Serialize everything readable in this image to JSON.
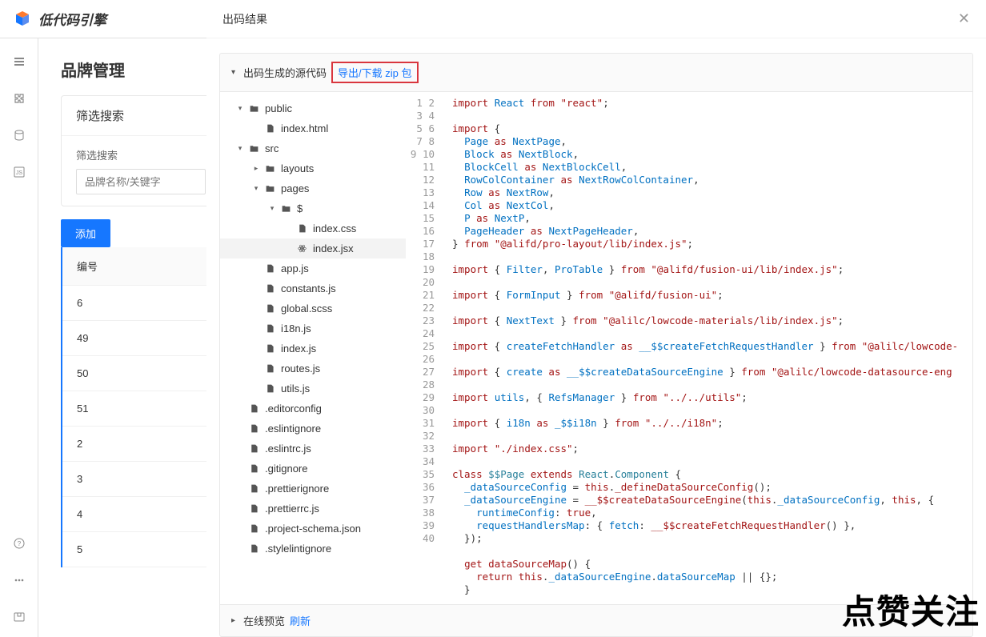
{
  "header": {
    "app_name": "低代码引擎"
  },
  "page": {
    "title": "品牌管理",
    "filter_panel_title": "筛选搜索",
    "filter_label": "筛选搜索",
    "filter_placeholder": "品牌名称/关键字",
    "add_button": "添加",
    "table_header": "编号",
    "rows": [
      "6",
      "49",
      "50",
      "51",
      "2",
      "3",
      "4",
      "5"
    ]
  },
  "modal": {
    "title": "出码结果",
    "section_title": "出码生成的源代码",
    "export_link": "导出/下载 zip 包",
    "footer_label": "在线预览",
    "footer_refresh": "刷新"
  },
  "tree": [
    {
      "d": 1,
      "caret": "v",
      "icon": "folder",
      "label": "public"
    },
    {
      "d": 2,
      "caret": "",
      "icon": "file",
      "label": "index.html"
    },
    {
      "d": 1,
      "caret": "v",
      "icon": "folder",
      "label": "src"
    },
    {
      "d": 2,
      "caret": ">",
      "icon": "folder",
      "label": "layouts"
    },
    {
      "d": 2,
      "caret": "v",
      "icon": "folder",
      "label": "pages"
    },
    {
      "d": 3,
      "caret": "v",
      "icon": "folder",
      "label": "$"
    },
    {
      "d": 4,
      "caret": "",
      "icon": "file",
      "label": "index.css"
    },
    {
      "d": 4,
      "caret": "",
      "icon": "react",
      "label": "index.jsx",
      "sel": true
    },
    {
      "d": 2,
      "caret": "",
      "icon": "file",
      "label": "app.js"
    },
    {
      "d": 2,
      "caret": "",
      "icon": "file",
      "label": "constants.js"
    },
    {
      "d": 2,
      "caret": "",
      "icon": "file",
      "label": "global.scss"
    },
    {
      "d": 2,
      "caret": "",
      "icon": "file",
      "label": "i18n.js"
    },
    {
      "d": 2,
      "caret": "",
      "icon": "file",
      "label": "index.js"
    },
    {
      "d": 2,
      "caret": "",
      "icon": "file",
      "label": "routes.js"
    },
    {
      "d": 2,
      "caret": "",
      "icon": "file",
      "label": "utils.js"
    },
    {
      "d": 1,
      "caret": "",
      "icon": "file",
      "label": ".editorconfig"
    },
    {
      "d": 1,
      "caret": "",
      "icon": "file",
      "label": ".eslintignore"
    },
    {
      "d": 1,
      "caret": "",
      "icon": "file",
      "label": ".eslintrc.js"
    },
    {
      "d": 1,
      "caret": "",
      "icon": "file",
      "label": ".gitignore"
    },
    {
      "d": 1,
      "caret": "",
      "icon": "file",
      "label": ".prettierignore"
    },
    {
      "d": 1,
      "caret": "",
      "icon": "file",
      "label": ".prettierrc.js"
    },
    {
      "d": 1,
      "caret": "",
      "icon": "file",
      "label": ".project-schema.json"
    },
    {
      "d": 1,
      "caret": "",
      "icon": "file",
      "label": ".stylelintignore"
    }
  ],
  "code": {
    "line_count": 40,
    "lines": [
      [
        [
          "kw",
          "import"
        ],
        [
          "pln",
          " "
        ],
        [
          "id",
          "React"
        ],
        [
          "pln",
          " "
        ],
        [
          "kw",
          "from"
        ],
        [
          "pln",
          " "
        ],
        [
          "str",
          "\"react\""
        ],
        [
          "pln",
          ";"
        ]
      ],
      [],
      [
        [
          "kw",
          "import"
        ],
        [
          "pln",
          " {"
        ]
      ],
      [
        [
          "pln",
          "  "
        ],
        [
          "id",
          "Page"
        ],
        [
          "pln",
          " "
        ],
        [
          "kw",
          "as"
        ],
        [
          "pln",
          " "
        ],
        [
          "id",
          "NextPage"
        ],
        [
          "pln",
          ","
        ]
      ],
      [
        [
          "pln",
          "  "
        ],
        [
          "id",
          "Block"
        ],
        [
          "pln",
          " "
        ],
        [
          "kw",
          "as"
        ],
        [
          "pln",
          " "
        ],
        [
          "id",
          "NextBlock"
        ],
        [
          "pln",
          ","
        ]
      ],
      [
        [
          "pln",
          "  "
        ],
        [
          "id",
          "BlockCell"
        ],
        [
          "pln",
          " "
        ],
        [
          "kw",
          "as"
        ],
        [
          "pln",
          " "
        ],
        [
          "id",
          "NextBlockCell"
        ],
        [
          "pln",
          ","
        ]
      ],
      [
        [
          "pln",
          "  "
        ],
        [
          "id",
          "RowColContainer"
        ],
        [
          "pln",
          " "
        ],
        [
          "kw",
          "as"
        ],
        [
          "pln",
          " "
        ],
        [
          "id",
          "NextRowColContainer"
        ],
        [
          "pln",
          ","
        ]
      ],
      [
        [
          "pln",
          "  "
        ],
        [
          "id",
          "Row"
        ],
        [
          "pln",
          " "
        ],
        [
          "kw",
          "as"
        ],
        [
          "pln",
          " "
        ],
        [
          "id",
          "NextRow"
        ],
        [
          "pln",
          ","
        ]
      ],
      [
        [
          "pln",
          "  "
        ],
        [
          "id",
          "Col"
        ],
        [
          "pln",
          " "
        ],
        [
          "kw",
          "as"
        ],
        [
          "pln",
          " "
        ],
        [
          "id",
          "NextCol"
        ],
        [
          "pln",
          ","
        ]
      ],
      [
        [
          "pln",
          "  "
        ],
        [
          "id",
          "P"
        ],
        [
          "pln",
          " "
        ],
        [
          "kw",
          "as"
        ],
        [
          "pln",
          " "
        ],
        [
          "id",
          "NextP"
        ],
        [
          "pln",
          ","
        ]
      ],
      [
        [
          "pln",
          "  "
        ],
        [
          "id",
          "PageHeader"
        ],
        [
          "pln",
          " "
        ],
        [
          "kw",
          "as"
        ],
        [
          "pln",
          " "
        ],
        [
          "id",
          "NextPageHeader"
        ],
        [
          "pln",
          ","
        ]
      ],
      [
        [
          "pln",
          "} "
        ],
        [
          "kw",
          "from"
        ],
        [
          "pln",
          " "
        ],
        [
          "str",
          "\"@alifd/pro-layout/lib/index.js\""
        ],
        [
          "pln",
          ";"
        ]
      ],
      [],
      [
        [
          "kw",
          "import"
        ],
        [
          "pln",
          " { "
        ],
        [
          "id",
          "Filter"
        ],
        [
          "pln",
          ", "
        ],
        [
          "id",
          "ProTable"
        ],
        [
          "pln",
          " } "
        ],
        [
          "kw",
          "from"
        ],
        [
          "pln",
          " "
        ],
        [
          "str",
          "\"@alifd/fusion-ui/lib/index.js\""
        ],
        [
          "pln",
          ";"
        ]
      ],
      [],
      [
        [
          "kw",
          "import"
        ],
        [
          "pln",
          " { "
        ],
        [
          "id",
          "FormInput"
        ],
        [
          "pln",
          " } "
        ],
        [
          "kw",
          "from"
        ],
        [
          "pln",
          " "
        ],
        [
          "str",
          "\"@alifd/fusion-ui\""
        ],
        [
          "pln",
          ";"
        ]
      ],
      [],
      [
        [
          "kw",
          "import"
        ],
        [
          "pln",
          " { "
        ],
        [
          "id",
          "NextText"
        ],
        [
          "pln",
          " } "
        ],
        [
          "kw",
          "from"
        ],
        [
          "pln",
          " "
        ],
        [
          "str",
          "\"@alilc/lowcode-materials/lib/index.js\""
        ],
        [
          "pln",
          ";"
        ]
      ],
      [],
      [
        [
          "kw",
          "import"
        ],
        [
          "pln",
          " { "
        ],
        [
          "id",
          "createFetchHandler"
        ],
        [
          "pln",
          " "
        ],
        [
          "kw",
          "as"
        ],
        [
          "pln",
          " "
        ],
        [
          "id",
          "__$$createFetchRequestHandler"
        ],
        [
          "pln",
          " } "
        ],
        [
          "kw",
          "from"
        ],
        [
          "pln",
          " "
        ],
        [
          "str",
          "\"@alilc/lowcode-"
        ]
      ],
      [],
      [
        [
          "kw",
          "import"
        ],
        [
          "pln",
          " { "
        ],
        [
          "id",
          "create"
        ],
        [
          "pln",
          " "
        ],
        [
          "kw",
          "as"
        ],
        [
          "pln",
          " "
        ],
        [
          "id",
          "__$$createDataSourceEngine"
        ],
        [
          "pln",
          " } "
        ],
        [
          "kw",
          "from"
        ],
        [
          "pln",
          " "
        ],
        [
          "str",
          "\"@alilc/lowcode-datasource-eng"
        ]
      ],
      [],
      [
        [
          "kw",
          "import"
        ],
        [
          "pln",
          " "
        ],
        [
          "id",
          "utils"
        ],
        [
          "pln",
          ", { "
        ],
        [
          "id",
          "RefsManager"
        ],
        [
          "pln",
          " } "
        ],
        [
          "kw",
          "from"
        ],
        [
          "pln",
          " "
        ],
        [
          "str",
          "\"../../utils\""
        ],
        [
          "pln",
          ";"
        ]
      ],
      [],
      [
        [
          "kw",
          "import"
        ],
        [
          "pln",
          " { "
        ],
        [
          "id",
          "i18n"
        ],
        [
          "pln",
          " "
        ],
        [
          "kw",
          "as"
        ],
        [
          "pln",
          " "
        ],
        [
          "id",
          "_$$i18n"
        ],
        [
          "pln",
          " } "
        ],
        [
          "kw",
          "from"
        ],
        [
          "pln",
          " "
        ],
        [
          "str",
          "\"../../i18n\""
        ],
        [
          "pln",
          ";"
        ]
      ],
      [],
      [
        [
          "kw",
          "import"
        ],
        [
          "pln",
          " "
        ],
        [
          "str",
          "\"./index.css\""
        ],
        [
          "pln",
          ";"
        ]
      ],
      [],
      [
        [
          "kw",
          "class"
        ],
        [
          "pln",
          " "
        ],
        [
          "cls",
          "$$Page"
        ],
        [
          "pln",
          " "
        ],
        [
          "kw",
          "extends"
        ],
        [
          "pln",
          " "
        ],
        [
          "cls",
          "React"
        ],
        [
          "pln",
          "."
        ],
        [
          "cls",
          "Component"
        ],
        [
          "pln",
          " {"
        ]
      ],
      [
        [
          "pln",
          "  "
        ],
        [
          "id",
          "_dataSourceConfig"
        ],
        [
          "pln",
          " = "
        ],
        [
          "kw",
          "this"
        ],
        [
          "pln",
          "."
        ],
        [
          "fn",
          "_defineDataSourceConfig"
        ],
        [
          "pln",
          "();"
        ]
      ],
      [
        [
          "pln",
          "  "
        ],
        [
          "id",
          "_dataSourceEngine"
        ],
        [
          "pln",
          " = "
        ],
        [
          "fn",
          "__$$createDataSourceEngine"
        ],
        [
          "pln",
          "("
        ],
        [
          "kw",
          "this"
        ],
        [
          "pln",
          "."
        ],
        [
          "id",
          "_dataSourceConfig"
        ],
        [
          "pln",
          ", "
        ],
        [
          "kw",
          "this"
        ],
        [
          "pln",
          ", {"
        ]
      ],
      [
        [
          "pln",
          "    "
        ],
        [
          "id",
          "runtimeConfig"
        ],
        [
          "pln",
          ": "
        ],
        [
          "kw",
          "true"
        ],
        [
          "pln",
          ","
        ]
      ],
      [
        [
          "pln",
          "    "
        ],
        [
          "id",
          "requestHandlersMap"
        ],
        [
          "pln",
          ": { "
        ],
        [
          "id",
          "fetch"
        ],
        [
          "pln",
          ": "
        ],
        [
          "fn",
          "__$$createFetchRequestHandler"
        ],
        [
          "pln",
          "() },"
        ]
      ],
      [
        [
          "pln",
          "  });"
        ]
      ],
      [],
      [
        [
          "pln",
          "  "
        ],
        [
          "kw",
          "get"
        ],
        [
          "pln",
          " "
        ],
        [
          "fn",
          "dataSourceMap"
        ],
        [
          "pln",
          "() {"
        ]
      ],
      [
        [
          "pln",
          "    "
        ],
        [
          "kw",
          "return"
        ],
        [
          "pln",
          " "
        ],
        [
          "kw",
          "this"
        ],
        [
          "pln",
          "."
        ],
        [
          "id",
          "_dataSourceEngine"
        ],
        [
          "pln",
          "."
        ],
        [
          "id",
          "dataSourceMap"
        ],
        [
          "pln",
          " || {};"
        ]
      ],
      [
        [
          "pln",
          "  }"
        ]
      ],
      []
    ]
  },
  "watermark": "点赞关注"
}
